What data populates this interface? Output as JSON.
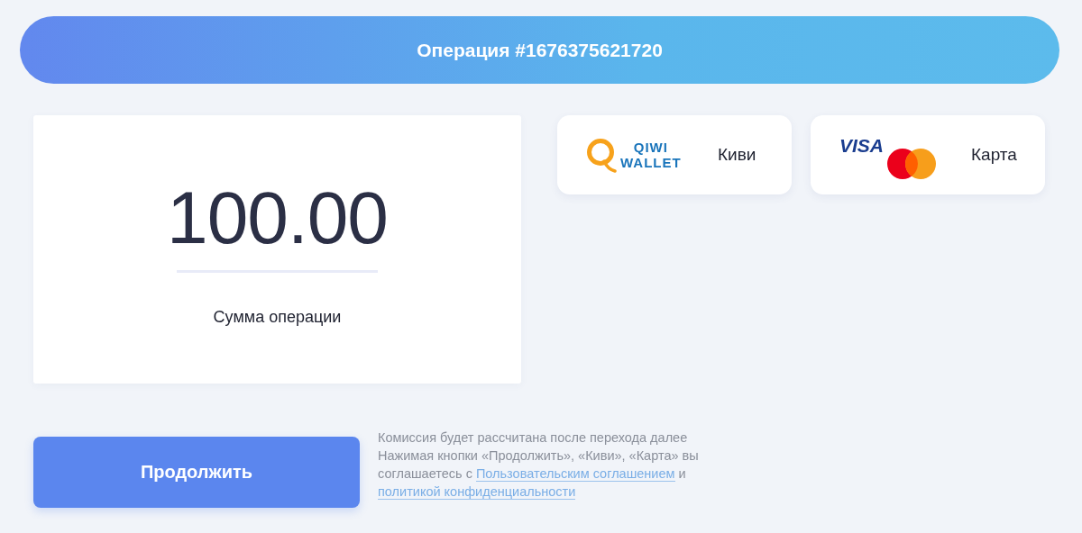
{
  "header": {
    "title": "Операция #1676375621720"
  },
  "amount": {
    "value": "100.00",
    "label": "Сумма операции"
  },
  "methods": [
    {
      "kind": "qiwi",
      "logo_lines": [
        "QIWI",
        "WALLET"
      ],
      "label": "Киви"
    },
    {
      "kind": "card",
      "logo_lines": [
        "VISA"
      ],
      "label": "Карта"
    }
  ],
  "continue_button": {
    "label": "Продолжить"
  },
  "note": {
    "commission": "Комиссия будет рассчитана после перехода далее",
    "agreement_before": "Нажимая кнопки «Продолжить», «Киви», «Карта» вы соглашаетесь с",
    "agreement_link": "Пользовательским соглашением",
    "agreement_middle": "и",
    "privacy_link": "политикой конфиденциальности"
  }
}
